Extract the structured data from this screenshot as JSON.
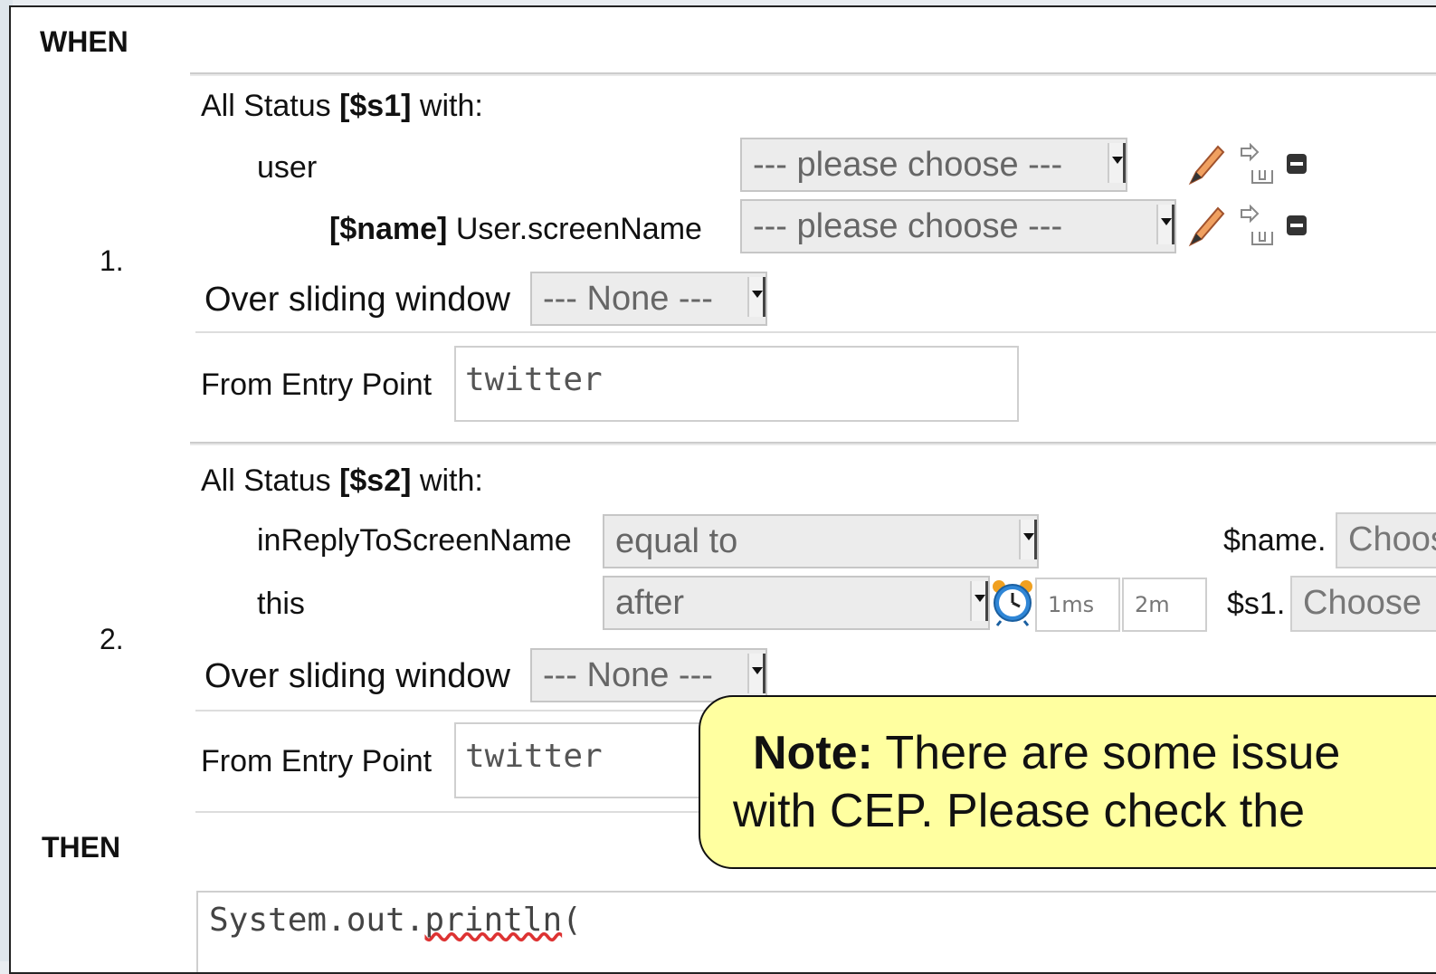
{
  "when_label": "WHEN",
  "then_label": "THEN",
  "patterns": [
    {
      "number": "1.",
      "header_prefix": "All Status",
      "binding": "[$s1]",
      "header_suffix": "with:",
      "rows": [
        {
          "field": "user",
          "operator": "--- please choose ---"
        },
        {
          "binding": "[$name]",
          "field": "User.screenName",
          "operator": "--- please choose ---"
        }
      ],
      "window_label": "Over sliding window",
      "window_value": "--- None ---",
      "entry_label": "From Entry Point",
      "entry_value": "twitter"
    },
    {
      "number": "2.",
      "header_prefix": "All Status",
      "binding": "[$s2]",
      "header_suffix": "with:",
      "rows": [
        {
          "field": "inReplyToScreenName",
          "operator": "equal to",
          "value_prefix": "$name.",
          "value_choose": "Choose"
        },
        {
          "field": "this",
          "operator": "after",
          "param1": "1ms",
          "param2": "2m",
          "value_prefix": "$s1.",
          "value_choose": "Choose"
        }
      ],
      "window_label": "Over sliding window",
      "window_value": "--- None ---",
      "entry_label": "From Entry Point",
      "entry_value": "twitter"
    }
  ],
  "note": {
    "bold": "Note:",
    "line1": "There are some issue",
    "line2": "with CEP. Please check the"
  },
  "code": {
    "prefix": "System.out.",
    "method": "println",
    "suffix": "("
  },
  "icons": {
    "edit": "pencil-icon",
    "expand": "expand-icon",
    "remove": "remove-icon",
    "clock": "alarm-clock-icon"
  }
}
